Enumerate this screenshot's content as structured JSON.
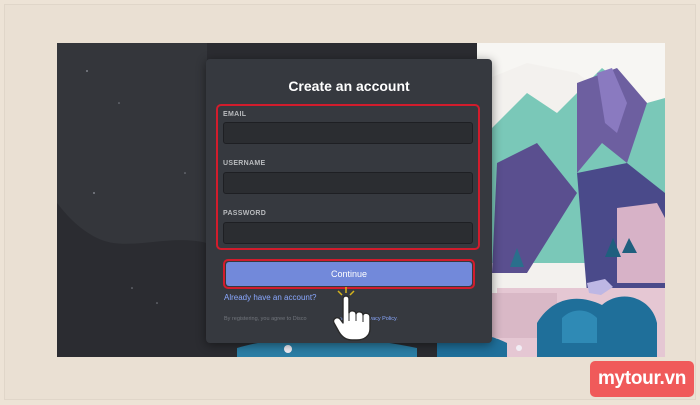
{
  "modal": {
    "title": "Create an account",
    "email_label": "EMAIL",
    "username_label": "USERNAME",
    "password_label": "PASSWORD",
    "email_value": "",
    "username_value": "",
    "password_value": "",
    "continue_label": "Continue",
    "login_link": "Already have an account?",
    "terms_prefix": "By registering, you agree to Disco",
    "terms_mid": "vice",
    "terms_and": "and",
    "privacy_link": "Privacy Policy",
    "terms_suffix": "."
  },
  "watermark": {
    "text": "mytour.vn"
  },
  "colors": {
    "highlight_border": "#d21c2c",
    "button": "#7289da",
    "link": "#8aa8ff",
    "modal_bg": "#36393f",
    "watermark_bg": "#f05a5a"
  },
  "icons": [
    "pointing-hand-icon"
  ]
}
